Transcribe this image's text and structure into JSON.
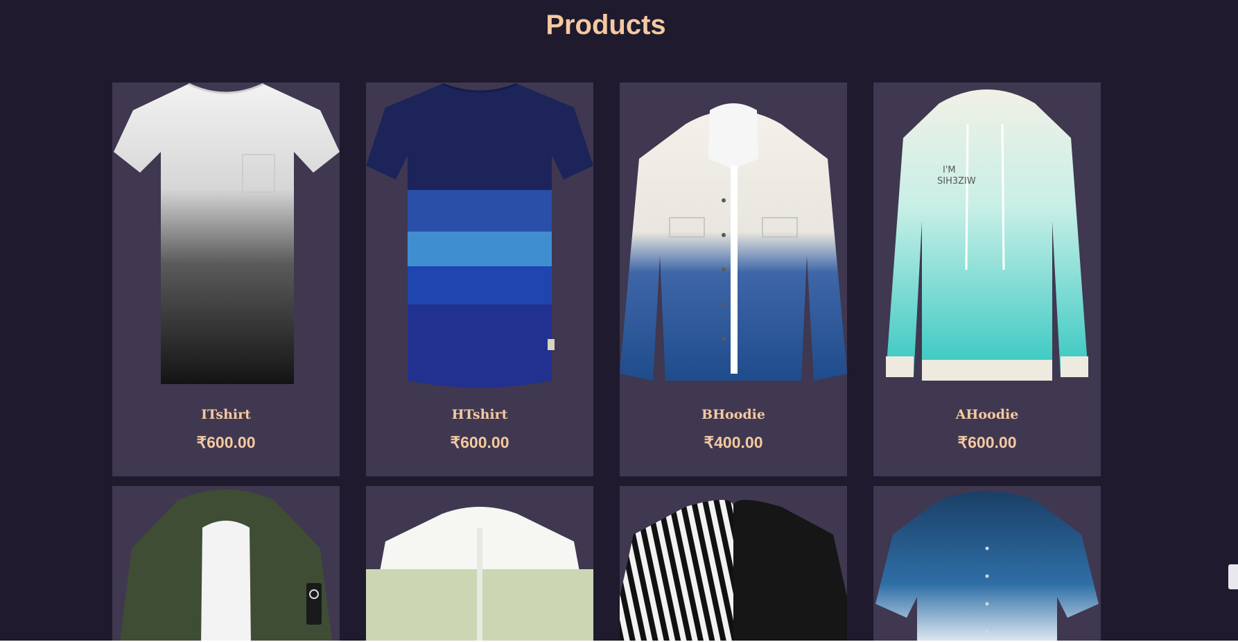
{
  "page": {
    "title": "Products"
  },
  "products": [
    {
      "name": "ITshirt",
      "price": "₹600.00",
      "image_icon": "gradient-white-black-tshirt-icon"
    },
    {
      "name": "HTshirt",
      "price": "₹600.00",
      "image_icon": "striped-blue-tshirt-icon"
    },
    {
      "name": "BHoodie",
      "price": "₹400.00",
      "image_icon": "white-blue-denim-jacket-icon"
    },
    {
      "name": "AHoodie",
      "price": "₹600.00",
      "image_icon": "white-aqua-hoodie-icon"
    },
    {
      "image_icon": "olive-green-jacket-icon"
    },
    {
      "image_icon": "white-sage-shirt-icon"
    },
    {
      "image_icon": "striped-black-shirt-icon"
    },
    {
      "image_icon": "blue-gradient-shirt-icon"
    }
  ],
  "colors": {
    "background": "#1f1a2e",
    "card": "#3f3850",
    "accent": "#f5c9a0"
  }
}
